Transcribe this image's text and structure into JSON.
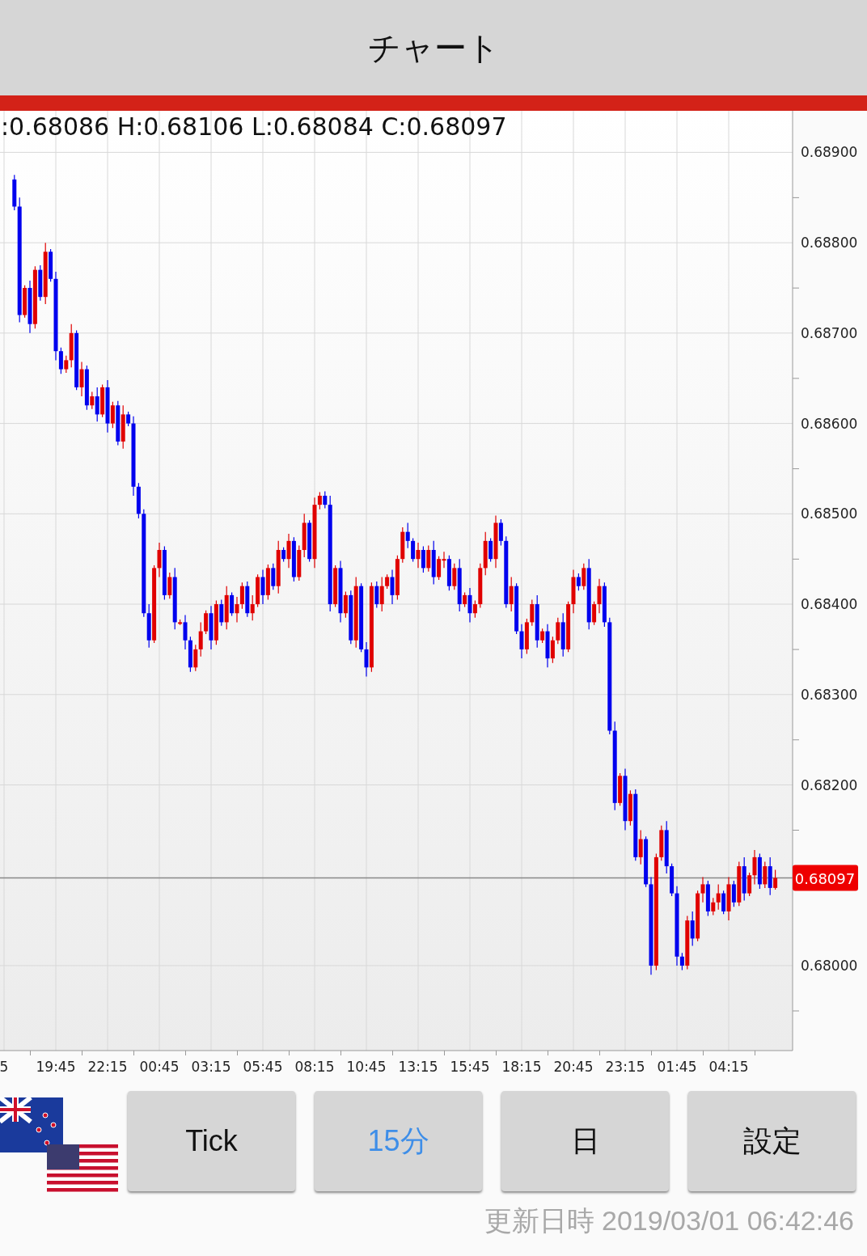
{
  "header": {
    "title": "チャート"
  },
  "chart": {
    "ohlc": ":0.68086 H:0.68106 L:0.68084 C:0.68097",
    "chart_data": {
      "type": "candlestick",
      "categories": [
        "5",
        null,
        null,
        null,
        null,
        null,
        null,
        null,
        null,
        null,
        "19:45",
        null,
        null,
        null,
        null,
        null,
        null,
        null,
        null,
        null,
        "22:15",
        null,
        null,
        null,
        null,
        null,
        null,
        null,
        null,
        null,
        "00:45",
        null,
        null,
        null,
        null,
        null,
        null,
        null,
        null,
        null,
        "03:15",
        null,
        null,
        null,
        null,
        null,
        null,
        null,
        null,
        null,
        "05:45",
        null,
        null,
        null,
        null,
        null,
        null,
        null,
        null,
        null,
        "08:15",
        null,
        null,
        null,
        null,
        null,
        null,
        null,
        null,
        null,
        "10:45",
        null,
        null,
        null,
        null,
        null,
        null,
        null,
        null,
        null,
        "13:15",
        null,
        null,
        null,
        null,
        null,
        null,
        null,
        null,
        null,
        "15:45",
        null,
        null,
        null,
        null,
        null,
        null,
        null,
        null,
        null,
        "18:15",
        null,
        null,
        null,
        null,
        null,
        null,
        null,
        null,
        null,
        "20:45",
        null,
        null,
        null,
        null,
        null,
        null,
        null,
        null,
        null,
        "23:15",
        null,
        null,
        null,
        null,
        null,
        null,
        null,
        null,
        null,
        "01:45",
        null,
        null,
        null,
        null,
        null,
        null,
        null,
        null,
        null,
        "04:15",
        null,
        null,
        null,
        null,
        null,
        null,
        null,
        null,
        null
      ],
      "ohlc": [
        null,
        null,
        [
          0.6887,
          0.68875,
          0.68836,
          0.6884
        ],
        [
          0.6884,
          0.6885,
          0.68712,
          0.6872
        ],
        [
          0.6872,
          0.68753,
          0.68717,
          0.6875
        ],
        [
          0.6875,
          0.68758,
          0.687,
          0.6871
        ],
        [
          0.6871,
          0.68774,
          0.68705,
          0.6877
        ],
        [
          0.6877,
          0.68775,
          0.68736,
          0.6874
        ],
        [
          0.6874,
          0.688,
          0.68732,
          0.6879
        ],
        [
          0.6879,
          0.68793,
          0.68757,
          0.6876
        ],
        [
          0.6876,
          0.68768,
          0.6867,
          0.6868
        ],
        [
          0.6868,
          0.68684,
          0.68655,
          0.6866
        ],
        [
          0.6866,
          0.68675,
          0.68656,
          0.6867
        ],
        [
          0.6867,
          0.6871,
          0.68662,
          0.687
        ],
        [
          0.687,
          0.68703,
          0.68637,
          0.6864
        ],
        [
          0.6864,
          0.68668,
          0.6863,
          0.6866
        ],
        [
          0.6866,
          0.68664,
          0.68615,
          0.6862
        ],
        [
          0.6862,
          0.68635,
          0.68616,
          0.6863
        ],
        [
          0.6863,
          0.6864,
          0.68602,
          0.6861
        ],
        [
          0.6861,
          0.68643,
          0.68607,
          0.6864
        ],
        [
          0.6864,
          0.68648,
          0.6859,
          0.686
        ],
        [
          0.686,
          0.68624,
          0.68595,
          0.6862
        ],
        [
          0.6862,
          0.68625,
          0.68576,
          0.6858
        ],
        [
          0.6858,
          0.6862,
          0.68572,
          0.6861
        ],
        [
          0.6861,
          0.68613,
          0.68597,
          0.686
        ],
        [
          0.686,
          0.68608,
          0.6852,
          0.6853
        ],
        [
          0.6853,
          0.68534,
          0.68495,
          0.685
        ],
        [
          0.685,
          0.68505,
          0.68386,
          0.6839
        ],
        [
          0.6839,
          0.684,
          0.68352,
          0.6836
        ],
        [
          0.6836,
          0.68443,
          0.68357,
          0.6844
        ],
        [
          0.6844,
          0.68468,
          0.6843,
          0.6846
        ],
        [
          0.6846,
          0.68464,
          0.68405,
          0.6841
        ],
        [
          0.6841,
          0.68435,
          0.68406,
          0.6843
        ],
        [
          0.6843,
          0.6844,
          0.68372,
          0.6838
        ],
        [
          0.6838,
          0.68383,
          0.68377,
          0.6838
        ],
        [
          0.6838,
          0.68388,
          0.6835,
          0.6836
        ],
        [
          0.6836,
          0.68364,
          0.68325,
          0.6833
        ],
        [
          0.6833,
          0.68355,
          0.68326,
          0.6835
        ],
        [
          0.6835,
          0.6838,
          0.68342,
          0.6837
        ],
        [
          0.6837,
          0.68393,
          0.68367,
          0.6839
        ],
        [
          0.6839,
          0.68398,
          0.6835,
          0.6836
        ],
        [
          0.6836,
          0.68404,
          0.68355,
          0.684
        ],
        [
          0.684,
          0.68405,
          0.68376,
          0.6838
        ],
        [
          0.6838,
          0.6842,
          0.68372,
          0.6841
        ],
        [
          0.6841,
          0.68413,
          0.68387,
          0.6839
        ],
        [
          0.6839,
          0.68408,
          0.6838,
          0.684
        ],
        [
          0.684,
          0.68424,
          0.68395,
          0.6842
        ],
        [
          0.6842,
          0.68425,
          0.68386,
          0.6839
        ],
        [
          0.6839,
          0.6841,
          0.68382,
          0.684
        ],
        [
          0.684,
          0.68433,
          0.68397,
          0.6843
        ],
        [
          0.6843,
          0.68438,
          0.684,
          0.6841
        ],
        [
          0.6841,
          0.68444,
          0.68405,
          0.6844
        ],
        [
          0.6844,
          0.68445,
          0.68416,
          0.6842
        ],
        [
          0.6842,
          0.6847,
          0.68412,
          0.6846
        ],
        [
          0.6846,
          0.68463,
          0.68447,
          0.6845
        ],
        [
          0.6845,
          0.68478,
          0.6844,
          0.6847
        ],
        [
          0.6847,
          0.68474,
          0.68425,
          0.6843
        ],
        [
          0.6843,
          0.68465,
          0.68426,
          0.6846
        ],
        [
          0.6846,
          0.685,
          0.68452,
          0.6849
        ],
        [
          0.6849,
          0.68493,
          0.68447,
          0.6845
        ],
        [
          0.6845,
          0.68518,
          0.6844,
          0.6851
        ],
        [
          0.6851,
          0.68524,
          0.68505,
          0.6852
        ],
        [
          0.6852,
          0.68525,
          0.68506,
          0.6851
        ],
        [
          0.6851,
          0.6852,
          0.68392,
          0.684
        ],
        [
          0.684,
          0.68443,
          0.68397,
          0.6844
        ],
        [
          0.6844,
          0.68448,
          0.6838,
          0.6839
        ],
        [
          0.6839,
          0.68414,
          0.68385,
          0.6841
        ],
        [
          0.6841,
          0.68415,
          0.68356,
          0.6836
        ],
        [
          0.6836,
          0.6843,
          0.68352,
          0.6842
        ],
        [
          0.6842,
          0.68423,
          0.68347,
          0.6835
        ],
        [
          0.6835,
          0.68358,
          0.6832,
          0.6833
        ],
        [
          0.6833,
          0.68424,
          0.68325,
          0.6842
        ],
        [
          0.6842,
          0.68425,
          0.68396,
          0.684
        ],
        [
          0.684,
          0.6843,
          0.68392,
          0.6842
        ],
        [
          0.6842,
          0.68433,
          0.68417,
          0.6843
        ],
        [
          0.6843,
          0.68438,
          0.684,
          0.6841
        ],
        [
          0.6841,
          0.68454,
          0.68405,
          0.6845
        ],
        [
          0.6845,
          0.68485,
          0.68446,
          0.6848
        ],
        [
          0.6848,
          0.6849,
          0.68462,
          0.6847
        ],
        [
          0.6847,
          0.68473,
          0.68447,
          0.6845
        ],
        [
          0.6845,
          0.68468,
          0.6844,
          0.6846
        ],
        [
          0.6846,
          0.68464,
          0.68435,
          0.6844
        ],
        [
          0.6844,
          0.68465,
          0.68436,
          0.6846
        ],
        [
          0.6846,
          0.6847,
          0.68422,
          0.6843
        ],
        [
          0.6843,
          0.68453,
          0.68427,
          0.6845
        ],
        [
          0.6845,
          0.68458,
          0.6844,
          0.6845
        ],
        [
          0.6845,
          0.68454,
          0.68415,
          0.6842
        ],
        [
          0.6842,
          0.68445,
          0.68416,
          0.6844
        ],
        [
          0.6844,
          0.6845,
          0.68392,
          0.684
        ],
        [
          0.684,
          0.68413,
          0.68397,
          0.6841
        ],
        [
          0.6841,
          0.68418,
          0.6838,
          0.6839
        ],
        [
          0.6839,
          0.68404,
          0.68385,
          0.684
        ],
        [
          0.684,
          0.68445,
          0.68396,
          0.6844
        ],
        [
          0.6844,
          0.6848,
          0.68432,
          0.6847
        ],
        [
          0.6847,
          0.68473,
          0.68447,
          0.6845
        ],
        [
          0.6845,
          0.68498,
          0.6844,
          0.6849
        ],
        [
          0.6849,
          0.68494,
          0.68465,
          0.6847
        ],
        [
          0.6847,
          0.68475,
          0.68396,
          0.684
        ],
        [
          0.684,
          0.6843,
          0.68392,
          0.6842
        ],
        [
          0.6842,
          0.68423,
          0.68367,
          0.6837
        ],
        [
          0.6837,
          0.68378,
          0.6834,
          0.6835
        ],
        [
          0.6835,
          0.68384,
          0.68345,
          0.6838
        ],
        [
          0.6838,
          0.68405,
          0.68376,
          0.684
        ],
        [
          0.684,
          0.6841,
          0.68352,
          0.6836
        ],
        [
          0.6836,
          0.68373,
          0.68357,
          0.6837
        ],
        [
          0.6837,
          0.68378,
          0.6833,
          0.6834
        ],
        [
          0.6834,
          0.68364,
          0.68335,
          0.6836
        ],
        [
          0.6836,
          0.68385,
          0.68356,
          0.6838
        ],
        [
          0.6838,
          0.6839,
          0.68342,
          0.6835
        ],
        [
          0.6835,
          0.68403,
          0.68347,
          0.684
        ],
        [
          0.684,
          0.68438,
          0.6839,
          0.6843
        ],
        [
          0.6843,
          0.68434,
          0.68415,
          0.6842
        ],
        [
          0.6842,
          0.68445,
          0.68416,
          0.6844
        ],
        [
          0.6844,
          0.6845,
          0.68372,
          0.6838
        ],
        [
          0.6838,
          0.68403,
          0.68377,
          0.684
        ],
        [
          0.684,
          0.68428,
          0.6839,
          0.6842
        ],
        [
          0.6842,
          0.68424,
          0.68375,
          0.6838
        ],
        [
          0.6838,
          0.68385,
          0.68256,
          0.6826
        ],
        [
          0.6826,
          0.6827,
          0.68172,
          0.6818
        ],
        [
          0.6818,
          0.68213,
          0.68177,
          0.6821
        ],
        [
          0.6821,
          0.68218,
          0.6815,
          0.6816
        ],
        [
          0.6816,
          0.68194,
          0.68155,
          0.6819
        ],
        [
          0.6819,
          0.68195,
          0.68116,
          0.6812
        ],
        [
          0.6812,
          0.6815,
          0.68112,
          0.6814
        ],
        [
          0.6814,
          0.68143,
          0.68087,
          0.6809
        ],
        [
          0.6809,
          0.68098,
          0.6799,
          0.68
        ],
        [
          0.68,
          0.68124,
          0.67995,
          0.6812
        ],
        [
          0.6812,
          0.68155,
          0.68116,
          0.6815
        ],
        [
          0.6815,
          0.6816,
          0.68102,
          0.6811
        ],
        [
          0.6811,
          0.68113,
          0.68077,
          0.6808
        ],
        [
          0.6808,
          0.68088,
          0.68,
          0.6801
        ],
        [
          0.6801,
          0.68014,
          0.67995,
          0.68
        ],
        [
          0.68,
          0.68055,
          0.67996,
          0.6805
        ],
        [
          0.6805,
          0.6806,
          0.68022,
          0.6803
        ],
        [
          0.6803,
          0.68083,
          0.68027,
          0.6808
        ],
        [
          0.6808,
          0.68098,
          0.6807,
          0.6809
        ],
        [
          0.6809,
          0.68094,
          0.68055,
          0.6806
        ],
        [
          0.6806,
          0.68075,
          0.68056,
          0.6807
        ],
        [
          0.6807,
          0.6809,
          0.68062,
          0.6808
        ],
        [
          0.6808,
          0.68083,
          0.68057,
          0.6806
        ],
        [
          0.6806,
          0.68098,
          0.6805,
          0.6809
        ],
        [
          0.6809,
          0.68094,
          0.68065,
          0.6807
        ],
        [
          0.6807,
          0.68115,
          0.68066,
          0.6811
        ],
        [
          0.6811,
          0.6812,
          0.68072,
          0.6808
        ],
        [
          0.6808,
          0.68103,
          0.68077,
          0.681
        ],
        [
          0.681,
          0.68128,
          0.6809,
          0.6812
        ],
        [
          0.6812,
          0.68124,
          0.68085,
          0.6809
        ],
        [
          0.6809,
          0.68115,
          0.68086,
          0.6811
        ],
        [
          0.6811,
          0.6812,
          0.68078,
          0.68086
        ],
        [
          0.68086,
          0.68106,
          0.68084,
          0.68097
        ]
      ],
      "ylim": [
        0.67906,
        0.68946
      ],
      "yticks": [
        {
          "value": 0.689,
          "label": "0.68900"
        },
        {
          "value": 0.688,
          "label": "0.68800"
        },
        {
          "value": 0.687,
          "label": "0.68700"
        },
        {
          "value": 0.686,
          "label": "0.68600"
        },
        {
          "value": 0.685,
          "label": "0.68500"
        },
        {
          "value": 0.684,
          "label": "0.68400"
        },
        {
          "value": 0.683,
          "label": "0.68300"
        },
        {
          "value": 0.682,
          "label": "0.68200"
        },
        {
          "value": 0.68,
          "label": "0.68000"
        }
      ],
      "grid": true,
      "ref_lines": [
        {
          "axis": "y",
          "value": 0.68097,
          "label": "0.68097"
        }
      ]
    }
  },
  "buttons": [
    {
      "label": "Tick",
      "selected": false
    },
    {
      "label": "15分",
      "selected": true
    },
    {
      "label": "日",
      "selected": false
    },
    {
      "label": "設定",
      "selected": false
    }
  ],
  "updated": "更新日時 2019/03/01 06:42:46"
}
